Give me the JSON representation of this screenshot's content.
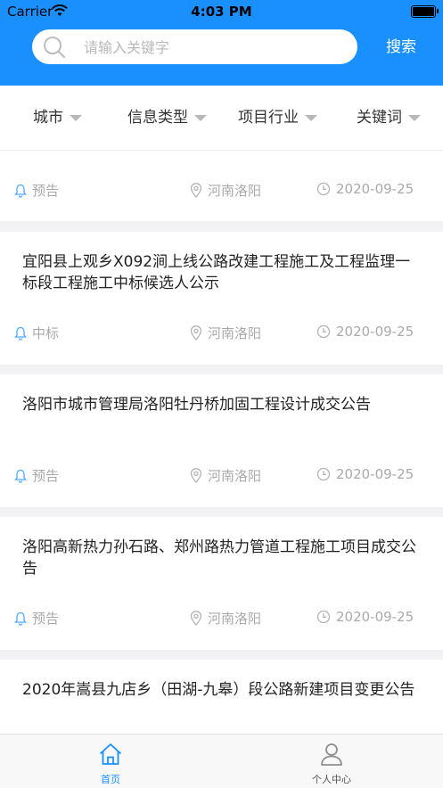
{
  "status_bar": {
    "carrier": "Carrier",
    "time": "4:03 PM"
  },
  "search": {
    "placeholder": "请输入关键字",
    "button_label": "搜索"
  },
  "filters": [
    {
      "label": "城市"
    },
    {
      "label": "信息类型"
    },
    {
      "label": "项目行业"
    },
    {
      "label": "关键词"
    }
  ],
  "cards": [
    {
      "title": "",
      "type": "预告",
      "location": "河南洛阳",
      "date": "2020-09-25"
    },
    {
      "title": "宜阳县上观乡X092涧上线公路改建工程施工及工程监理一标段工程施工中标候选人公示",
      "type": "中标",
      "location": "河南洛阳",
      "date": "2020-09-25"
    },
    {
      "title": "洛阳市城市管理局洛阳牡丹桥加固工程设计成交公告",
      "type": "预告",
      "location": "河南洛阳",
      "date": "2020-09-25"
    },
    {
      "title": "洛阳高新热力孙石路、郑州路热力管道工程施工项目成交公告",
      "type": "预告",
      "location": "河南洛阳",
      "date": "2020-09-25"
    },
    {
      "title": "2020年嵩县九店乡（田湖-九皋）段公路新建项目变更公告",
      "type": "",
      "location": "",
      "date": ""
    }
  ],
  "tabbar": {
    "items": [
      {
        "label": "首页",
        "active": true
      },
      {
        "label": "个人中心",
        "active": false
      }
    ]
  },
  "colors": {
    "primary": "#1a90ff",
    "muted": "#a9a9a9",
    "bell": "#4fa8ff"
  }
}
